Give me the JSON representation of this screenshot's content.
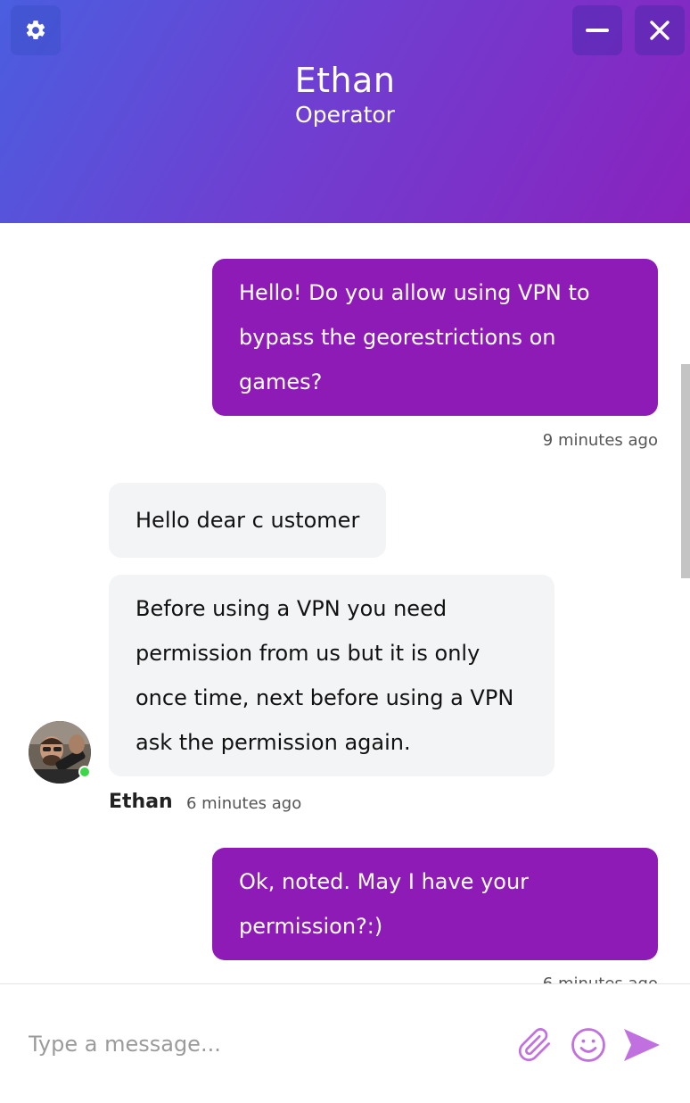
{
  "header": {
    "agent_name": "Ethan",
    "agent_role": "Operator",
    "settings_icon": "gear-icon",
    "minimize_icon": "minimize-icon",
    "close_icon": "close-icon",
    "gradient_start": "#4a5ee0",
    "gradient_end": "#8a22be"
  },
  "messages": [
    {
      "direction": "outgoing",
      "text": "Hello! Do you allow using VPN to bypass the georestrictions on games?",
      "time": "9 minutes ago"
    },
    {
      "direction": "incoming",
      "text": "Hello dear c ustomer"
    },
    {
      "direction": "incoming",
      "text": "Before using a VPN you need permission from us but it is only once time, next before using a VPN ask the permission again.",
      "sender": "Ethan",
      "time": "6 minutes ago"
    },
    {
      "direction": "outgoing",
      "text": "Ok, noted. May I have your permission?:)",
      "time": "6 minutes ago"
    }
  ],
  "composer": {
    "placeholder": "Type a message...",
    "attach_icon": "paperclip-icon",
    "emoji_icon": "smiley-icon",
    "send_icon": "send-icon",
    "accent_color": "#c170e0"
  },
  "colors": {
    "outgoing_bubble": "#8e1bb6",
    "incoming_bubble": "#f3f4f6",
    "online_status": "#3cd64a"
  }
}
